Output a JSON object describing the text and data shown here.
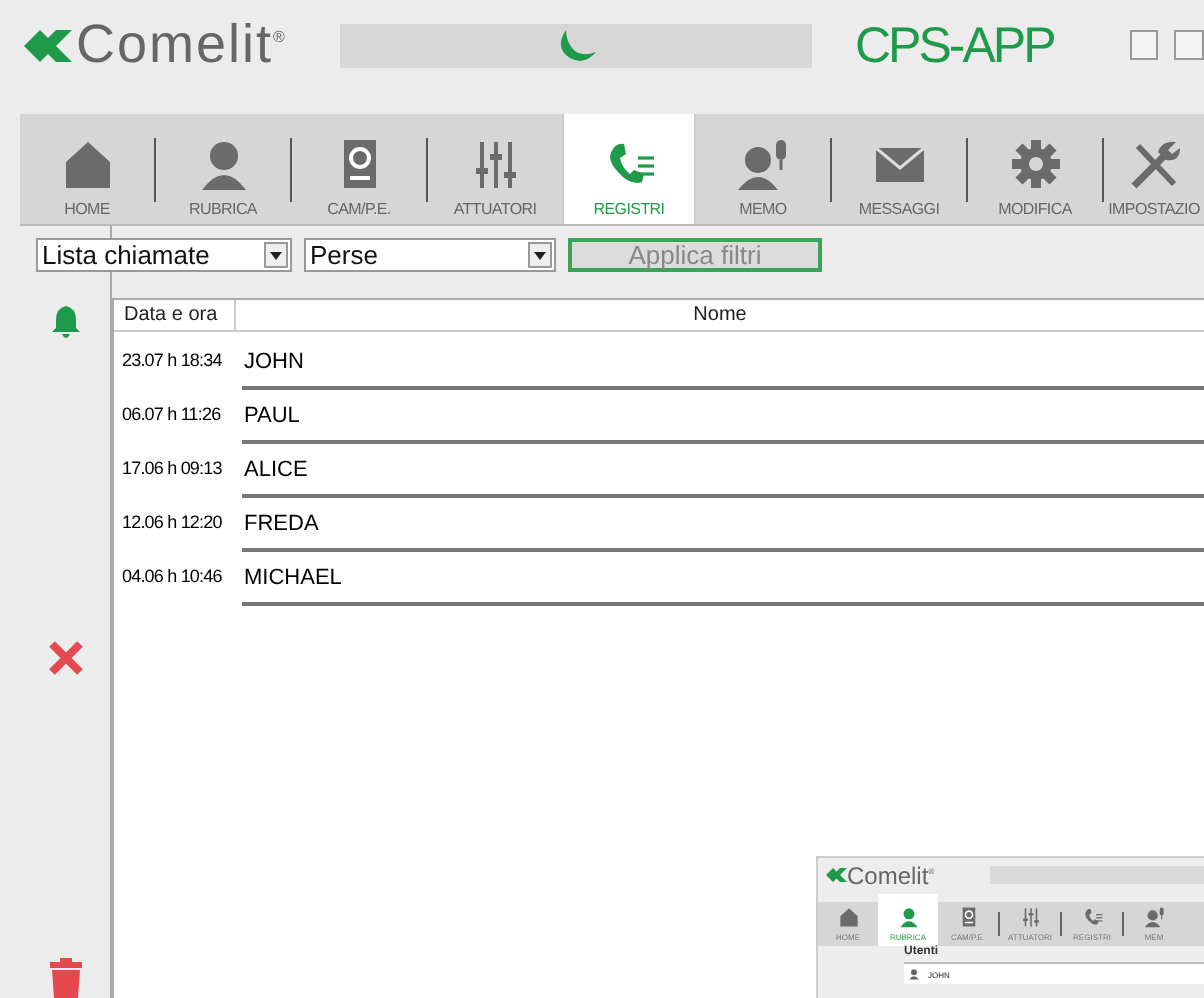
{
  "header": {
    "logo": "Comelit$^{®}$",
    "app_title": "CPS-APP"
  },
  "tabs": [
    {
      "label": "HOME",
      "selected": false
    },
    {
      "label": "RUBRICA",
      "selected": false
    },
    {
      "label": "CAM/P.E.",
      "selected": false
    },
    {
      "label": "ATTUATORI",
      "selected": false
    },
    {
      "label": "REGISTRI",
      "selected": true
    },
    {
      "label": "MEMO",
      "selected": false
    },
    {
      "label": "MESSAGGI",
      "selected": false
    },
    {
      "label": "MODIFICA",
      "selected": false
    },
    {
      "label": "IMPOSTAZIO",
      "selected": false
    }
  ],
  "filters": {
    "list": "Lista chiamate",
    "type": "Perse",
    "apply": {
      "label": "Applica filtri",
      "disabled": true
    }
  },
  "table": {
    "columns": [
      "Data e ora",
      "Nome"
    ],
    "rows": [
      {
        "date": "23.07 h 18:34",
        "name": "JOHN"
      },
      {
        "date": "06.07 h 11:26",
        "name": "PAUL"
      },
      {
        "date": "17.06 h 09:13",
        "name": "ALICE"
      },
      {
        "date": "12.06 h 12:20",
        "name": "FREDA"
      },
      {
        "date": "04.06 h 10:46",
        "name": "MICHAEL"
      }
    ]
  },
  "inset": {
    "logo": "Comelit$^{®}$",
    "tabs": [
      {
        "label": "HOME",
        "selected": false
      },
      {
        "label": "RUBRICA",
        "selected": true
      },
      {
        "label": "CAM/P.E.",
        "selected": false
      },
      {
        "label": "ATTUATORI",
        "selected": false
      },
      {
        "label": "REGISTRI",
        "selected": false
      },
      {
        "label": "MEM",
        "selected": false
      }
    ],
    "section": "Utenti",
    "rows": [
      "JOHN"
    ]
  }
}
